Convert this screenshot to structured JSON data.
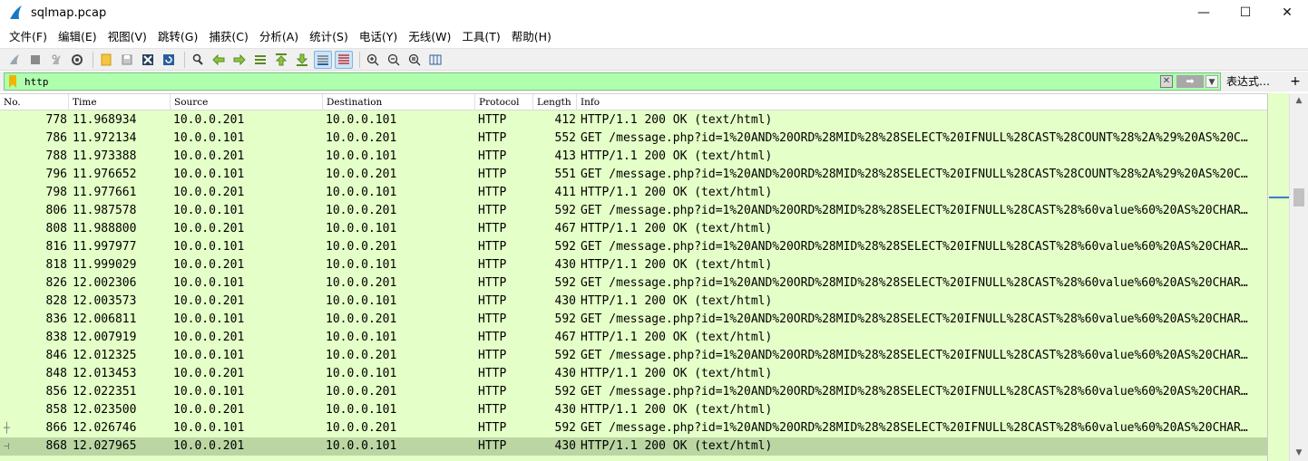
{
  "window": {
    "title": "sqlmap.pcap",
    "minimize_glyph": "—",
    "maximize_glyph": "☐",
    "close_glyph": "✕"
  },
  "menu": [
    "文件(F)",
    "编辑(E)",
    "视图(V)",
    "跳转(G)",
    "捕获(C)",
    "分析(A)",
    "统计(S)",
    "电话(Y)",
    "无线(W)",
    "工具(T)",
    "帮助(H)"
  ],
  "filter": {
    "value": "http",
    "clear_glyph": "✕",
    "apply_glyph": "➡",
    "dropdown_glyph": "▼",
    "expression_label": "表达式…",
    "add_glyph": "+"
  },
  "columns": {
    "no": "No.",
    "time": "Time",
    "source": "Source",
    "destination": "Destination",
    "protocol": "Protocol",
    "length": "Length",
    "info": "Info"
  },
  "packets": [
    {
      "no": "778",
      "time": "11.968934",
      "source": "10.0.0.201",
      "destination": "10.0.0.101",
      "protocol": "HTTP",
      "length": "412",
      "info": "HTTP/1.1 200 OK  (text/html)"
    },
    {
      "no": "786",
      "time": "11.972134",
      "source": "10.0.0.101",
      "destination": "10.0.0.201",
      "protocol": "HTTP",
      "length": "552",
      "info": "GET /message.php?id=1%20AND%20ORD%28MID%28%28SELECT%20IFNULL%28CAST%28COUNT%28%2A%29%20AS%20C…"
    },
    {
      "no": "788",
      "time": "11.973388",
      "source": "10.0.0.201",
      "destination": "10.0.0.101",
      "protocol": "HTTP",
      "length": "413",
      "info": "HTTP/1.1 200 OK  (text/html)"
    },
    {
      "no": "796",
      "time": "11.976652",
      "source": "10.0.0.101",
      "destination": "10.0.0.201",
      "protocol": "HTTP",
      "length": "551",
      "info": "GET /message.php?id=1%20AND%20ORD%28MID%28%28SELECT%20IFNULL%28CAST%28COUNT%28%2A%29%20AS%20C…"
    },
    {
      "no": "798",
      "time": "11.977661",
      "source": "10.0.0.201",
      "destination": "10.0.0.101",
      "protocol": "HTTP",
      "length": "411",
      "info": "HTTP/1.1 200 OK  (text/html)"
    },
    {
      "no": "806",
      "time": "11.987578",
      "source": "10.0.0.101",
      "destination": "10.0.0.201",
      "protocol": "HTTP",
      "length": "592",
      "info": "GET /message.php?id=1%20AND%20ORD%28MID%28%28SELECT%20IFNULL%28CAST%28%60value%60%20AS%20CHAR…"
    },
    {
      "no": "808",
      "time": "11.988800",
      "source": "10.0.0.201",
      "destination": "10.0.0.101",
      "protocol": "HTTP",
      "length": "467",
      "info": "HTTP/1.1 200 OK  (text/html)"
    },
    {
      "no": "816",
      "time": "11.997977",
      "source": "10.0.0.101",
      "destination": "10.0.0.201",
      "protocol": "HTTP",
      "length": "592",
      "info": "GET /message.php?id=1%20AND%20ORD%28MID%28%28SELECT%20IFNULL%28CAST%28%60value%60%20AS%20CHAR…"
    },
    {
      "no": "818",
      "time": "11.999029",
      "source": "10.0.0.201",
      "destination": "10.0.0.101",
      "protocol": "HTTP",
      "length": "430",
      "info": "HTTP/1.1 200 OK  (text/html)"
    },
    {
      "no": "826",
      "time": "12.002306",
      "source": "10.0.0.101",
      "destination": "10.0.0.201",
      "protocol": "HTTP",
      "length": "592",
      "info": "GET /message.php?id=1%20AND%20ORD%28MID%28%28SELECT%20IFNULL%28CAST%28%60value%60%20AS%20CHAR…"
    },
    {
      "no": "828",
      "time": "12.003573",
      "source": "10.0.0.201",
      "destination": "10.0.0.101",
      "protocol": "HTTP",
      "length": "430",
      "info": "HTTP/1.1 200 OK  (text/html)"
    },
    {
      "no": "836",
      "time": "12.006811",
      "source": "10.0.0.101",
      "destination": "10.0.0.201",
      "protocol": "HTTP",
      "length": "592",
      "info": "GET /message.php?id=1%20AND%20ORD%28MID%28%28SELECT%20IFNULL%28CAST%28%60value%60%20AS%20CHAR…"
    },
    {
      "no": "838",
      "time": "12.007919",
      "source": "10.0.0.201",
      "destination": "10.0.0.101",
      "protocol": "HTTP",
      "length": "467",
      "info": "HTTP/1.1 200 OK  (text/html)"
    },
    {
      "no": "846",
      "time": "12.012325",
      "source": "10.0.0.101",
      "destination": "10.0.0.201",
      "protocol": "HTTP",
      "length": "592",
      "info": "GET /message.php?id=1%20AND%20ORD%28MID%28%28SELECT%20IFNULL%28CAST%28%60value%60%20AS%20CHAR…"
    },
    {
      "no": "848",
      "time": "12.013453",
      "source": "10.0.0.201",
      "destination": "10.0.0.101",
      "protocol": "HTTP",
      "length": "430",
      "info": "HTTP/1.1 200 OK  (text/html)"
    },
    {
      "no": "856",
      "time": "12.022351",
      "source": "10.0.0.101",
      "destination": "10.0.0.201",
      "protocol": "HTTP",
      "length": "592",
      "info": "GET /message.php?id=1%20AND%20ORD%28MID%28%28SELECT%20IFNULL%28CAST%28%60value%60%20AS%20CHAR…"
    },
    {
      "no": "858",
      "time": "12.023500",
      "source": "10.0.0.201",
      "destination": "10.0.0.101",
      "protocol": "HTTP",
      "length": "430",
      "info": "HTTP/1.1 200 OK  (text/html)"
    },
    {
      "no": "866",
      "time": "12.026746",
      "source": "10.0.0.101",
      "destination": "10.0.0.201",
      "protocol": "HTTP",
      "length": "592",
      "info": "GET /message.php?id=1%20AND%20ORD%28MID%28%28SELECT%20IFNULL%28CAST%28%60value%60%20AS%20CHAR…"
    },
    {
      "no": "868",
      "time": "12.027965",
      "source": "10.0.0.201",
      "destination": "10.0.0.101",
      "protocol": "HTTP",
      "length": "430",
      "info": "HTTP/1.1 200 OK  (text/html)",
      "selected": true
    }
  ],
  "colors": {
    "filter_valid_bg": "#afffaf",
    "http_row_bg": "#e4ffc7",
    "selected_row_bg": "#bbd6a3"
  },
  "toolbar_icons": [
    "start-capture-icon",
    "stop-capture-icon",
    "restart-capture-icon",
    "capture-options-icon",
    "open-file-icon",
    "save-file-icon",
    "close-file-icon",
    "reload-file-icon",
    "find-packet-icon",
    "go-back-icon",
    "go-forward-icon",
    "go-to-packet-icon",
    "first-packet-icon",
    "last-packet-icon",
    "autoscroll-icon",
    "colorize-icon",
    "zoom-in-icon",
    "zoom-out-icon",
    "zoom-normal-icon",
    "resize-columns-icon"
  ]
}
